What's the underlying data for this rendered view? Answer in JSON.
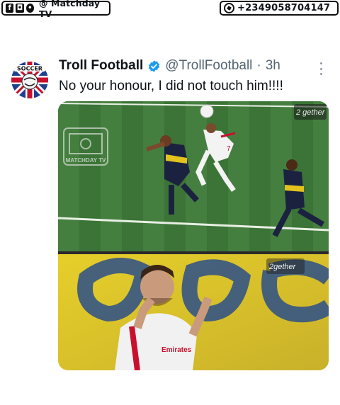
{
  "watermark": {
    "social_icons": [
      "facebook-icon",
      "instagram-icon",
      "twitter-icon"
    ],
    "handle": "@ Matchday TV",
    "whatsapp_icon": "whatsapp-icon",
    "phone": "+2349058704147"
  },
  "tweet": {
    "author_name": "Troll Football",
    "verified": true,
    "handle": "@TrollFootball",
    "separator": "·",
    "time": "3h",
    "text": "No your honour, I did not touch him!!!!",
    "avatar_text": "SOCCER"
  },
  "media": {
    "top_image": {
      "description_icon": "football-pitch-photo",
      "channel_logo_text": "2 gether",
      "watermark_text": "MATCHDAY TV",
      "player_number": "7"
    },
    "bottom_image": {
      "channel_logo_text": "2gether",
      "sponsor_text": "Emirates"
    }
  },
  "colors": {
    "verified_blue": "#1d9bf0",
    "pitch_green": "#3f7a3a",
    "banner_yellow": "#e6cf2a"
  }
}
